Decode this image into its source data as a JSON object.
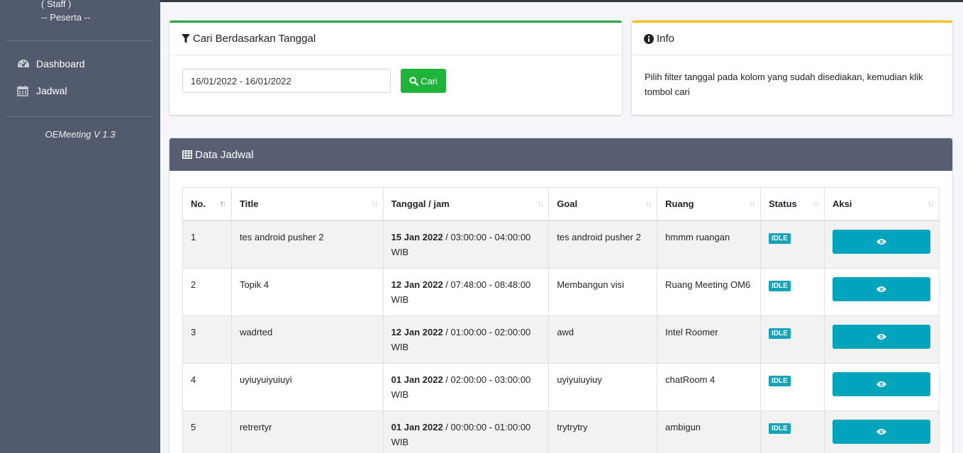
{
  "sidebar": {
    "user_role_1": "( Staff )",
    "user_role_2": "-- Peserta --",
    "menu": [
      {
        "label": "Dashboard",
        "icon": "dashboard-icon"
      },
      {
        "label": "Jadwal",
        "icon": "calendar-icon"
      }
    ],
    "version": "OEMeeting V 1.3"
  },
  "filter": {
    "title": "Cari Berdasarkan Tanggal",
    "date_range": "16/01/2022 - 16/01/2022",
    "search_label": "Cari"
  },
  "info": {
    "title": "Info",
    "text": "Pilih filter tanggal pada kolom yang sudah disediakan, kemudian klik tombol cari"
  },
  "data": {
    "title": "Data Jadwal",
    "columns": [
      "No.",
      "Title",
      "Tanggal / jam",
      "Goal",
      "Ruang",
      "Status",
      "Aksi"
    ],
    "rows": [
      {
        "no": "1",
        "title": "tes android pusher 2",
        "date": "15 Jan 2022",
        "time": " / 03:00:00 - 04:00:00",
        "tz": "WIB",
        "goal": "tes android pusher 2",
        "room": "hmmm ruangan",
        "status": "IDLE"
      },
      {
        "no": "2",
        "title": "Topik 4",
        "date": "12 Jan 2022",
        "time": " / 07:48:00 - 08:48:00",
        "tz": "WIB",
        "goal": "Membangun visi",
        "room": "Ruang Meeting OM6",
        "status": "IDLE"
      },
      {
        "no": "3",
        "title": "wadrted",
        "date": "12 Jan 2022",
        "time": " / 01:00:00 - 02:00:00",
        "tz": "WIB",
        "goal": "awd",
        "room": "Intel Roomer",
        "status": "IDLE"
      },
      {
        "no": "4",
        "title": "uyiuyuiyuiuyi",
        "date": "01 Jan 2022",
        "time": " / 02:00:00 - 03:00:00",
        "tz": "WIB",
        "goal": "uyiyuiuyiuy",
        "room": "chatRoom 4",
        "status": "IDLE"
      },
      {
        "no": "5",
        "title": "retrertyr",
        "date": "01 Jan 2022",
        "time": " / 00:00:00 - 01:00:00",
        "tz": "WIB",
        "goal": "trytrytry",
        "room": "ambigun",
        "status": "IDLE"
      }
    ]
  },
  "colors": {
    "sidebar": "#525a6e",
    "success": "#1fb33a",
    "warning": "#ffc107",
    "info": "#00a5bd"
  }
}
